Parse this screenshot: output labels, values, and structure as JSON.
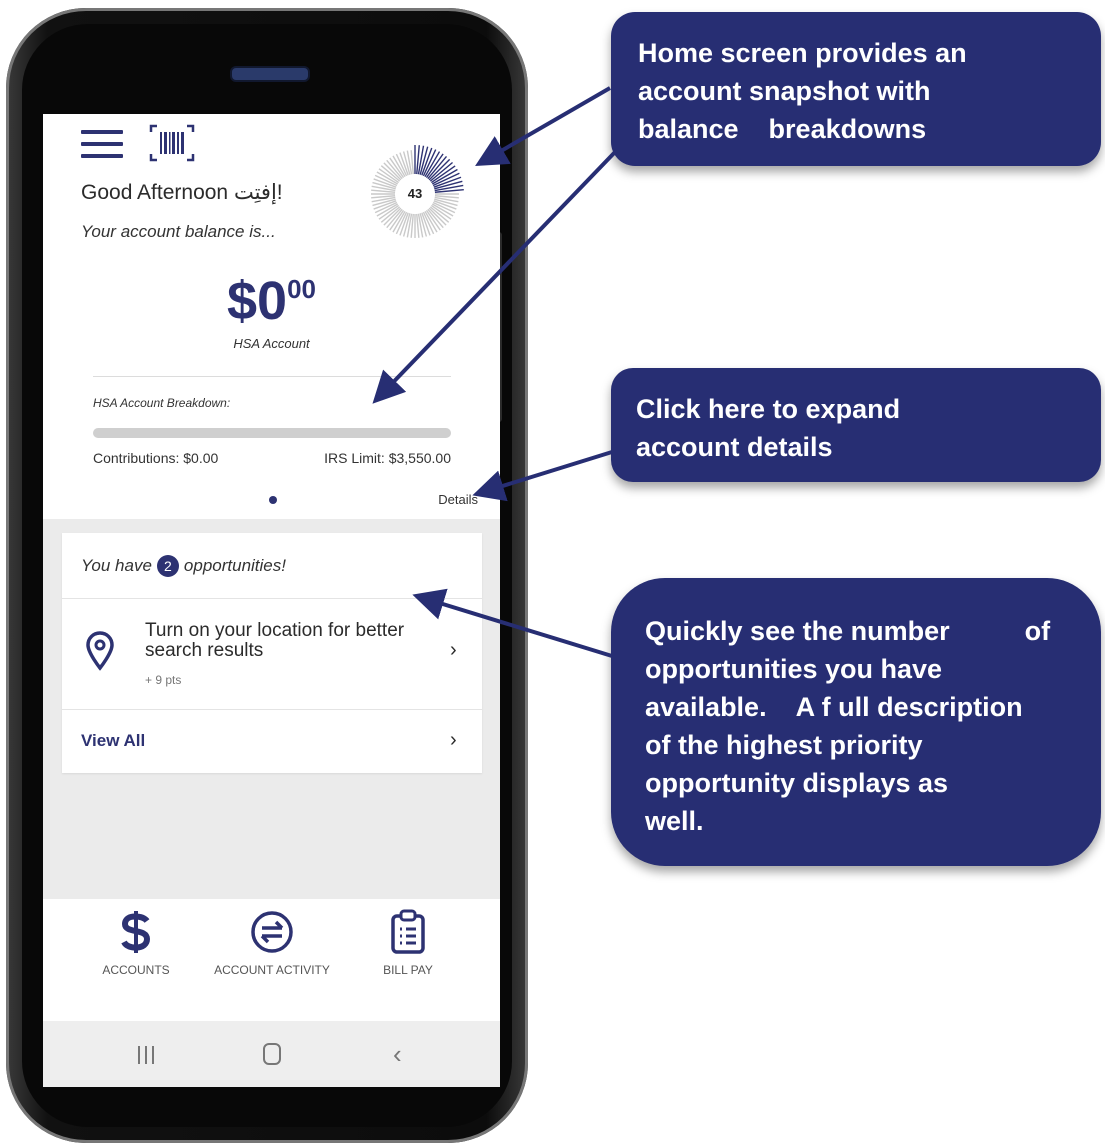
{
  "app": {
    "greeting": "Good Afternoon إفتِت!",
    "balance_caption": "Your account balance is...",
    "score": "43",
    "balance_dollars": "$0",
    "balance_cents": "00",
    "account_name": "HSA Account",
    "breakdown_title": "HSA Account Breakdown:",
    "contributions": "Contributions: $0.00",
    "irs_limit": "IRS Limit: $3,550.00",
    "contribution_fraction": 0,
    "details_label": "Details"
  },
  "opportunities": {
    "prefix": "You have",
    "count": "2",
    "suffix": "opportunities!",
    "top_item": {
      "text": "Turn on your location for better search results",
      "points": "+ 9 pts",
      "icon": "location-pin-icon"
    },
    "view_all": "View All"
  },
  "tabs": [
    {
      "label": "ACCOUNTS",
      "icon": "dollar-icon"
    },
    {
      "label": "ACCOUNT ACTIVITY",
      "icon": "transfer-icon"
    },
    {
      "label": "BILL PAY",
      "icon": "clipboard-icon"
    }
  ],
  "system_nav": {
    "recents": "recents-icon",
    "home": "home-icon",
    "back": "back-icon"
  },
  "callouts": [
    {
      "lines": [
        "Home screen provides an",
        "account snapshot with",
        "balance    breakdowns"
      ]
    },
    {
      "lines": [
        "Click here to expand",
        "account details"
      ]
    },
    {
      "lines": [
        "Quickly see the number          of",
        "opportunities you have",
        "available.    A f ull description",
        "of the highest priority",
        "opportunity displays as",
        "well."
      ]
    }
  ],
  "colors": {
    "brand": "#2d3272",
    "callout": "#272e73",
    "feed_background": "#ebebeb"
  }
}
